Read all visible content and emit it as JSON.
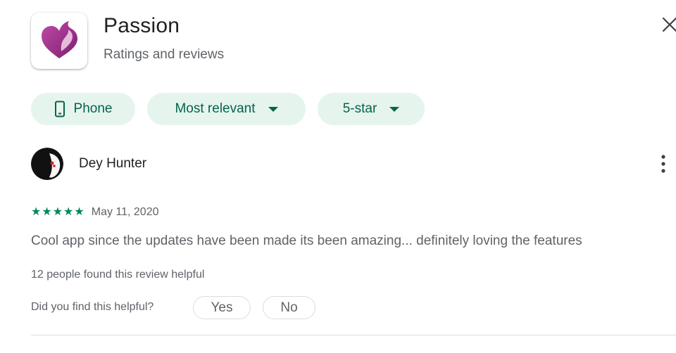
{
  "header": {
    "app_name": "Passion",
    "subtitle": "Ratings and reviews",
    "app_icon": "heart-flame-logo",
    "close_icon": "close-icon"
  },
  "filters": [
    {
      "label": "Phone",
      "icon": "phone-icon",
      "has_dropdown": false
    },
    {
      "label": "Most relevant",
      "icon": null,
      "has_dropdown": true
    },
    {
      "label": "5-star",
      "icon": null,
      "has_dropdown": true
    }
  ],
  "review": {
    "reviewer_name": "Dey Hunter",
    "stars": [
      "★",
      "★",
      "★",
      "★",
      "★"
    ],
    "rating": 5,
    "date": "May 11, 2020",
    "text": "Cool app since the updates have been made its been amazing... definitely loving the features",
    "helpful_count_text": "12 people found this review helpful",
    "helpful_question": "Did you find this helpful?",
    "yes_label": "Yes",
    "no_label": "No",
    "more_icon": "more-vert-icon"
  },
  "colors": {
    "accent": "#056449",
    "chip_bg": "#e6f4ee",
    "star": "#01875f",
    "secondary_text": "#5f6368",
    "logo_primary": "#9c2a8a"
  }
}
